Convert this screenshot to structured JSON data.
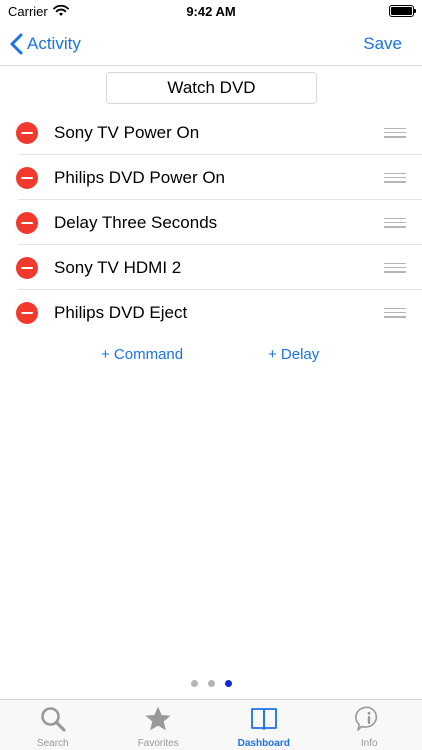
{
  "status_bar": {
    "carrier": "Carrier",
    "time": "9:42 AM"
  },
  "nav": {
    "back_label": "Activity",
    "save_label": "Save"
  },
  "activity": {
    "title": "Watch DVD"
  },
  "commands": [
    {
      "label": "Sony TV Power On"
    },
    {
      "label": "Philips DVD Power On"
    },
    {
      "label": "Delay Three Seconds"
    },
    {
      "label": "Sony TV HDMI 2"
    },
    {
      "label": "Philips DVD Eject"
    }
  ],
  "actions": {
    "add_command": "+ Command",
    "add_delay": "+ Delay"
  },
  "page_indicator": {
    "count": 3,
    "current": 3
  },
  "tabs": [
    {
      "label": "Search",
      "icon": "search-icon"
    },
    {
      "label": "Favorites",
      "icon": "star-icon"
    },
    {
      "label": "Dashboard",
      "icon": "book-icon",
      "active": true
    },
    {
      "label": "Info",
      "icon": "info-icon"
    }
  ],
  "colors": {
    "accent": "#1a73e8",
    "delete": "#f2392e",
    "page_dot_active": "#1226d8"
  }
}
